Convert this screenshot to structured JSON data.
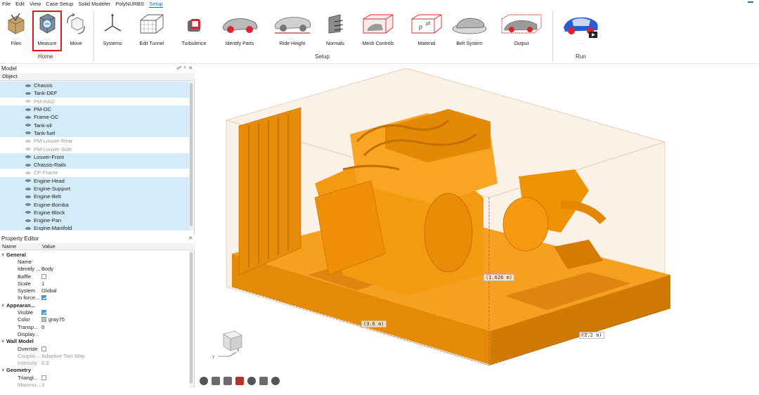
{
  "menu": {
    "items": [
      "File",
      "Edit",
      "View",
      "Case Setup",
      "Solid Modeler",
      "PolyNURBS",
      "Setup"
    ],
    "active": "Setup"
  },
  "ribbon": {
    "groups": {
      "home": "Home",
      "setup": "Setup",
      "run": "Run"
    },
    "tools": {
      "files": "Files",
      "measure": "Measure",
      "move": "Move",
      "systems": "Systems",
      "edit_tunnel": "Edit Tunnel",
      "turbulence": "Turbulence",
      "identify_parts": "Identify Parts",
      "ride_height": "Ride Height",
      "normals": "Normals",
      "mesh_controls": "Mesh Controls",
      "material": "Material",
      "belt_system": "Belt System",
      "output": "Output"
    },
    "accent_color": "#e3171b"
  },
  "model_panel": {
    "title": "Model",
    "column": "Object",
    "items": [
      {
        "label": "Chassis",
        "selected": true,
        "dim": false
      },
      {
        "label": "Tank-DEF",
        "selected": true,
        "dim": false
      },
      {
        "label": "PM-RAD",
        "selected": false,
        "dim": true
      },
      {
        "label": "PM-OC",
        "selected": true,
        "dim": false
      },
      {
        "label": "Frame-OC",
        "selected": true,
        "dim": false
      },
      {
        "label": "Tank-oil",
        "selected": true,
        "dim": false
      },
      {
        "label": "Tank-fuel",
        "selected": true,
        "dim": false
      },
      {
        "label": "PM-Louver-Rear",
        "selected": false,
        "dim": true
      },
      {
        "label": "PM-Louver-Side",
        "selected": false,
        "dim": true
      },
      {
        "label": "Louver-Front",
        "selected": true,
        "dim": false
      },
      {
        "label": "Chassis-Rails",
        "selected": true,
        "dim": false
      },
      {
        "label": "CP-Frame",
        "selected": false,
        "dim": true
      },
      {
        "label": "Engine-Head",
        "selected": true,
        "dim": false
      },
      {
        "label": "Engine-Support",
        "selected": true,
        "dim": false
      },
      {
        "label": "Engine-Belt",
        "selected": true,
        "dim": false
      },
      {
        "label": "Engine-Bomba",
        "selected": true,
        "dim": false
      },
      {
        "label": "Engine-Block",
        "selected": true,
        "dim": false
      },
      {
        "label": "Engine-Pan",
        "selected": true,
        "dim": false
      },
      {
        "label": "Engine-Manifold",
        "selected": true,
        "dim": false
      }
    ]
  },
  "property_editor": {
    "title": "Property Editor",
    "col_name": "Name",
    "col_value": "Value",
    "rows": [
      {
        "type": "group",
        "k": "General"
      },
      {
        "type": "prop",
        "k": "Name",
        "v": ""
      },
      {
        "type": "prop",
        "k": "Identify ...",
        "v": "Body"
      },
      {
        "type": "check",
        "k": "Baffle",
        "on": false
      },
      {
        "type": "prop",
        "k": "Scale",
        "v": "1"
      },
      {
        "type": "prop",
        "k": "System",
        "v": "Global"
      },
      {
        "type": "check",
        "k": "In force...",
        "on": true
      },
      {
        "type": "group",
        "k": "Appearan..."
      },
      {
        "type": "check",
        "k": "Visible",
        "on": true
      },
      {
        "type": "color",
        "k": "Color",
        "v": "gray75"
      },
      {
        "type": "prop",
        "k": "Transp...",
        "v": "0"
      },
      {
        "type": "prop",
        "k": "Display...",
        "v": ""
      },
      {
        "type": "group",
        "k": "Wall Model"
      },
      {
        "type": "check",
        "k": "Override",
        "on": false
      },
      {
        "type": "muted",
        "k": "Couplin...",
        "v": "Adaptive Two Way"
      },
      {
        "type": "muted",
        "k": "Intensity",
        "v": "0.3"
      },
      {
        "type": "group",
        "k": "Geometry"
      },
      {
        "type": "check",
        "k": "Triangl...",
        "on": false
      },
      {
        "type": "muted",
        "k": "Maximu...",
        "v": "3"
      }
    ]
  },
  "viewport": {
    "measurements": {
      "height": "(1.626 m)",
      "length": "(3.6 m)",
      "width": "(2.2 m)"
    },
    "model_color": "#f0960a",
    "box_color": "#f5e3cf"
  }
}
